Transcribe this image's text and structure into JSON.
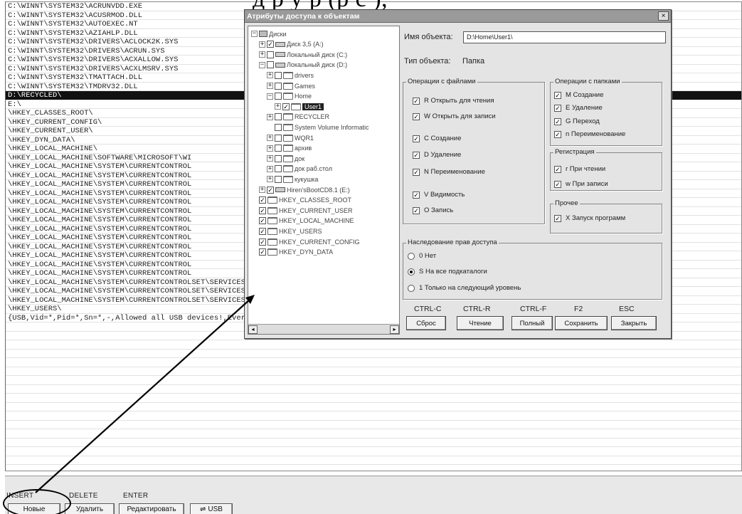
{
  "doc_heading": "д                  р  у р   (р  с   ),",
  "list": {
    "rows": [
      "C:\\WINNT\\SYSTEM32\\ACRUNVDD.EXE",
      "C:\\WINNT\\SYSTEM32\\ACUSRMOD.DLL",
      "C:\\WINNT\\SYSTEM32\\AUTOEXEC.NT",
      "C:\\WINNT\\SYSTEM32\\AZIAHLP.DLL",
      "C:\\WINNT\\SYSTEM32\\DRIVERS\\ACLOCK2K.SYS",
      "C:\\WINNT\\SYSTEM32\\DRIVERS\\ACRUN.SYS",
      "C:\\WINNT\\SYSTEM32\\DRIVERS\\ACXALLOW.SYS",
      "C:\\WINNT\\SYSTEM32\\DRIVERS\\ACXLMSRV.SYS",
      "C:\\WINNT\\SYSTEM32\\TMATTACH.DLL",
      "C:\\WINNT\\SYSTEM32\\TMDRV32.DLL",
      "D:\\RECYCLED\\",
      "E:\\",
      "\\HKEY_CLASSES_ROOT\\",
      "\\HKEY_CURRENT_CONFIG\\",
      "\\HKEY_CURRENT_USER\\",
      "\\HKEY_DYN_DATA\\",
      "\\HKEY_LOCAL_MACHINE\\",
      "\\HKEY_LOCAL_MACHINE\\SOFTWARE\\MICROSOFT\\WI",
      "\\HKEY_LOCAL_MACHINE\\SYSTEM\\CURRENTCONTROL",
      "\\HKEY_LOCAL_MACHINE\\SYSTEM\\CURRENTCONTROL",
      "\\HKEY_LOCAL_MACHINE\\SYSTEM\\CURRENTCONTROL",
      "\\HKEY_LOCAL_MACHINE\\SYSTEM\\CURRENTCONTROL",
      "\\HKEY_LOCAL_MACHINE\\SYSTEM\\CURRENTCONTROL",
      "\\HKEY_LOCAL_MACHINE\\SYSTEM\\CURRENTCONTROL",
      "\\HKEY_LOCAL_MACHINE\\SYSTEM\\CURRENTCONTROL",
      "\\HKEY_LOCAL_MACHINE\\SYSTEM\\CURRENTCONTROL",
      "\\HKEY_LOCAL_MACHINE\\SYSTEM\\CURRENTCONTROL",
      "\\HKEY_LOCAL_MACHINE\\SYSTEM\\CURRENTCONTROL",
      "\\HKEY_LOCAL_MACHINE\\SYSTEM\\CURRENTCONTROL",
      "\\HKEY_LOCAL_MACHINE\\SYSTEM\\CURRENTCONTROL",
      "\\HKEY_LOCAL_MACHINE\\SYSTEM\\CURRENTCONTROL",
      "\\HKEY_LOCAL_MACHINE\\SYSTEM\\CURRENTCONTROLSET\\SERVICES\\ACRUN\\",
      "\\HKEY_LOCAL_MACHINE\\SYSTEM\\CURRENTCONTROLSET\\SERVICES\\ACXALLOW\\",
      "\\HKEY_LOCAL_MACHINE\\SYSTEM\\CURRENTCONTROLSET\\SERVICES\\ACXLMSRV\\",
      "\\HKEY_USERS\\",
      "{USB,Vid=*,Pid=*,Sn=*,-,Allowed all USB devices!,Everywhere}"
    ],
    "selected_index": 10
  },
  "bottom": {
    "hotkeys": [
      "INSERT",
      "DELETE",
      "ENTER"
    ],
    "buttons": [
      "Новые",
      "Удалить",
      "Редактировать",
      "USB"
    ]
  },
  "dialog": {
    "title": "Атрибуты доступа к объектам",
    "close": "×",
    "tree": [
      {
        "label": "Диски",
        "exp": "−",
        "cb": "",
        "icon": "computer",
        "lvl": 0
      },
      {
        "label": "Диск 3,5 (A:)",
        "exp": "+",
        "cb": "✓",
        "icon": "drive",
        "lvl": 1
      },
      {
        "label": "Локальный диск (C:)",
        "exp": "+",
        "cb": "",
        "icon": "drive",
        "lvl": 1
      },
      {
        "label": "Локальный диск (D:)",
        "exp": "−",
        "cb": "",
        "icon": "drive",
        "lvl": 1
      },
      {
        "label": "drivers",
        "exp": "+",
        "cb": "",
        "icon": "folder",
        "lvl": 2
      },
      {
        "label": "Games",
        "exp": "+",
        "cb": "",
        "icon": "folder",
        "lvl": 2
      },
      {
        "label": "Home",
        "exp": "−",
        "cb": "",
        "icon": "folder",
        "lvl": 2
      },
      {
        "label": "User1",
        "exp": "+",
        "cb": "✓",
        "icon": "folder",
        "lvl": 3,
        "sel": true
      },
      {
        "label": "RECYCLER",
        "exp": "+",
        "cb": "",
        "icon": "folder",
        "lvl": 2
      },
      {
        "label": "System Volume Informatic",
        "exp": "",
        "cb": "",
        "icon": "folder",
        "lvl": 2
      },
      {
        "label": "WQR1",
        "exp": "+",
        "cb": "",
        "icon": "folder",
        "lvl": 2
      },
      {
        "label": "архив",
        "exp": "+",
        "cb": "",
        "icon": "folder",
        "lvl": 2
      },
      {
        "label": "док",
        "exp": "+",
        "cb": "",
        "icon": "folder",
        "lvl": 2
      },
      {
        "label": "док раб.стол",
        "exp": "+",
        "cb": "",
        "icon": "folder",
        "lvl": 2
      },
      {
        "label": "кукушка",
        "exp": "+",
        "cb": "",
        "icon": "folder",
        "lvl": 2
      },
      {
        "label": "Hiren'sBootCD8.1 (E:)",
        "exp": "+",
        "cb": "✓",
        "icon": "drive",
        "lvl": 1
      },
      {
        "label": "HKEY_CLASSES_ROOT",
        "exp": "",
        "cb": "✓",
        "icon": "folder",
        "lvl": 0
      },
      {
        "label": "HKEY_CURRENT_USER",
        "exp": "",
        "cb": "✓",
        "icon": "folder",
        "lvl": 0
      },
      {
        "label": "HKEY_LOCAL_MACHINE",
        "exp": "",
        "cb": "✓",
        "icon": "folder",
        "lvl": 0
      },
      {
        "label": "HKEY_USERS",
        "exp": "",
        "cb": "✓",
        "icon": "folder",
        "lvl": 0
      },
      {
        "label": "HKEY_CURRENT_CONFIG",
        "exp": "",
        "cb": "✓",
        "icon": "folder",
        "lvl": 0
      },
      {
        "label": "HKEY_DYN_DATA",
        "exp": "",
        "cb": "✓",
        "icon": "folder",
        "lvl": 0
      }
    ],
    "object_name_label": "Имя объекта:",
    "object_name_value": "D:\\Home\\User1\\",
    "object_type_label": "Тип объекта:",
    "object_type_value": "Папка",
    "file_ops": {
      "title": "Операции с файлами",
      "items": [
        "R Открыть для чтения",
        "W Открыть для записи",
        "C Создание",
        "D Удаление",
        "N Переименование",
        "V Видимость",
        "O Запись"
      ]
    },
    "folder_ops": {
      "title": "Операции с папками",
      "items": [
        "M Создание",
        "E Удаление",
        "G Переход",
        "n Переименование"
      ]
    },
    "registration": {
      "title": "Регистрация",
      "items": [
        "r При чтении",
        "w При записи"
      ]
    },
    "other": {
      "title": "Прочее",
      "items": [
        "X Запуск программ"
      ]
    },
    "inherit": {
      "title": "Наследование прав доступа",
      "options": [
        "0 Нет",
        "S На все подкаталоги",
        "1 Только на следующий уровень"
      ],
      "selected": 1
    },
    "hotkeys": [
      "CTRL-C",
      "CTRL-R",
      "CTRL-F",
      "F2",
      "ESC"
    ],
    "buttons": [
      "Сброс",
      "Чтение",
      "Полный",
      "Сохранить",
      "Закрыть"
    ]
  }
}
